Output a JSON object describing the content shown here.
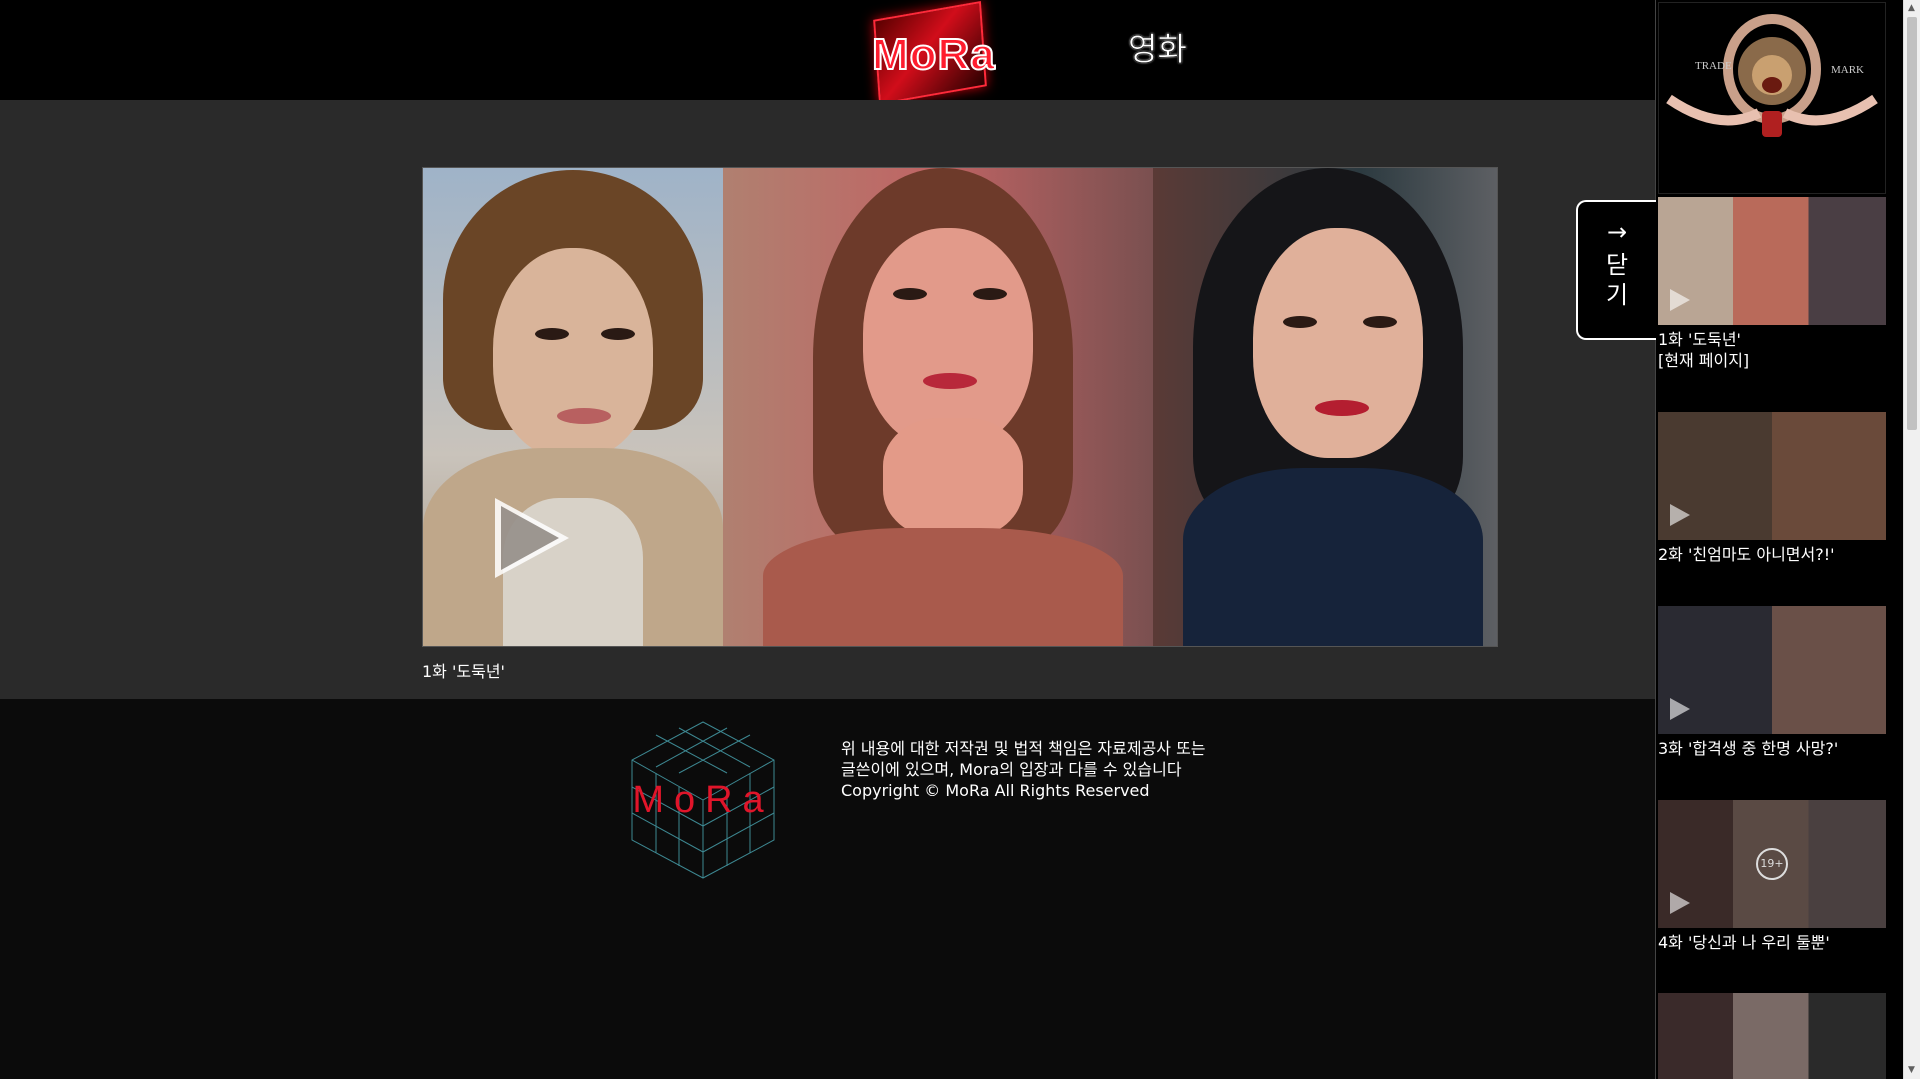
{
  "header": {
    "logo_text": "MoRa",
    "nav_movies": "영화"
  },
  "player": {
    "episode_title": "1화 '도둑년'"
  },
  "footer": {
    "logo_text": "MoRa",
    "line1": "위 내용에 대한 저작권 및 법적 책임은 자료제공사 또는",
    "line2": "글쓴이에 있으며, Mora의 입장과 다를 수 있습니다",
    "line3": "Copyright © MoRa All Rights Reserved"
  },
  "sidebar": {
    "logo": {
      "left_text": "TRADE",
      "right_text": "MARK"
    },
    "episodes": [
      {
        "label": "1화 '도둑년'\n[현재 페이지]"
      },
      {
        "label": "2화 '친엄마도 아니면서?!'"
      },
      {
        "label": "3화 '합격생 중 한명 사망?'"
      },
      {
        "label": "4화 '당신과 나 우리 둘뿐'",
        "badge": "19+"
      },
      {
        "label": ""
      }
    ]
  },
  "close_tab": {
    "arrow": "→",
    "label": "닫기"
  },
  "colors": {
    "brand_red": "#ff1c2e",
    "main_bg": "#2a2a2a",
    "footer_bg": "#0b0b0b",
    "header_bg": "#000000"
  }
}
